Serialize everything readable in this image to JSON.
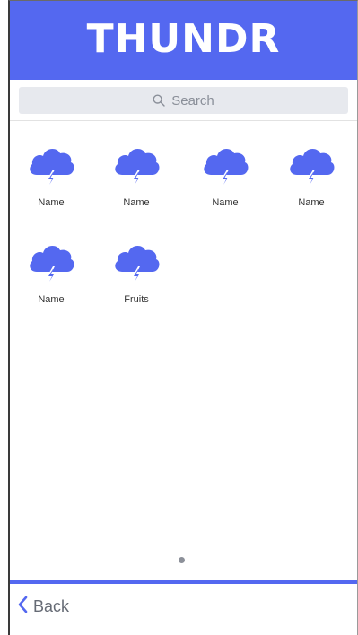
{
  "header": {
    "title": "THUNDR",
    "color": "#5468f0"
  },
  "search": {
    "placeholder": "Search",
    "icon": "search-icon"
  },
  "apps": [
    {
      "label": "Name",
      "icon": "cloud-lightning-icon"
    },
    {
      "label": "Name",
      "icon": "cloud-lightning-icon"
    },
    {
      "label": "Name",
      "icon": "cloud-lightning-icon"
    },
    {
      "label": "Name",
      "icon": "cloud-lightning-icon"
    },
    {
      "label": "Name",
      "icon": "cloud-lightning-icon"
    },
    {
      "label": "Fruits",
      "icon": "cloud-lightning-icon"
    }
  ],
  "pager": {
    "current_page": 1,
    "page_count": 1
  },
  "footer": {
    "back_label": "Back",
    "icon": "chevron-left-icon"
  }
}
